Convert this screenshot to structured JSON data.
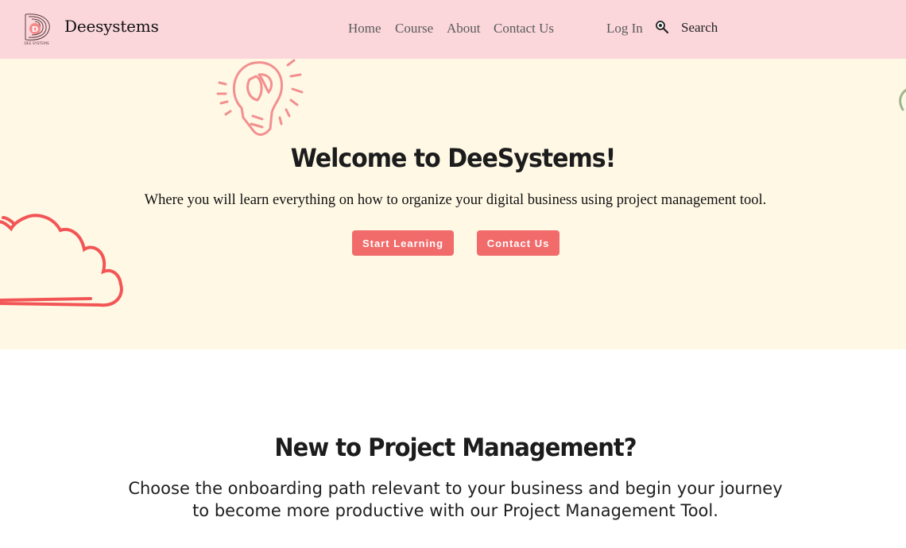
{
  "header": {
    "brand": "Deesystems",
    "logo_letter": "D",
    "logo_caption": "DEE SYSTEMS",
    "nav": [
      "Home",
      "Course",
      "About",
      "Contact Us"
    ],
    "login_label": "Log In",
    "search_label": "Search",
    "search_icon": "search-icon",
    "background_color": "#fbd7dc"
  },
  "hero": {
    "title": "Welcome to DeeSystems!",
    "subtitle": "Where you will learn everything on how to organize your digital business using project management tool.",
    "buttons": {
      "start": "Start Learning",
      "contact": "Contact Us"
    },
    "background_color": "#fff8e5",
    "accent_color": "#f16b6b",
    "decorations": [
      "lightbulb-brain-icon",
      "cloud-icon",
      "leaf-icon"
    ]
  },
  "section": {
    "title": "New to Project Management?",
    "subtitle": "Choose the onboarding path relevant to your business and begin your journey to become more productive with our Project Management Tool."
  }
}
